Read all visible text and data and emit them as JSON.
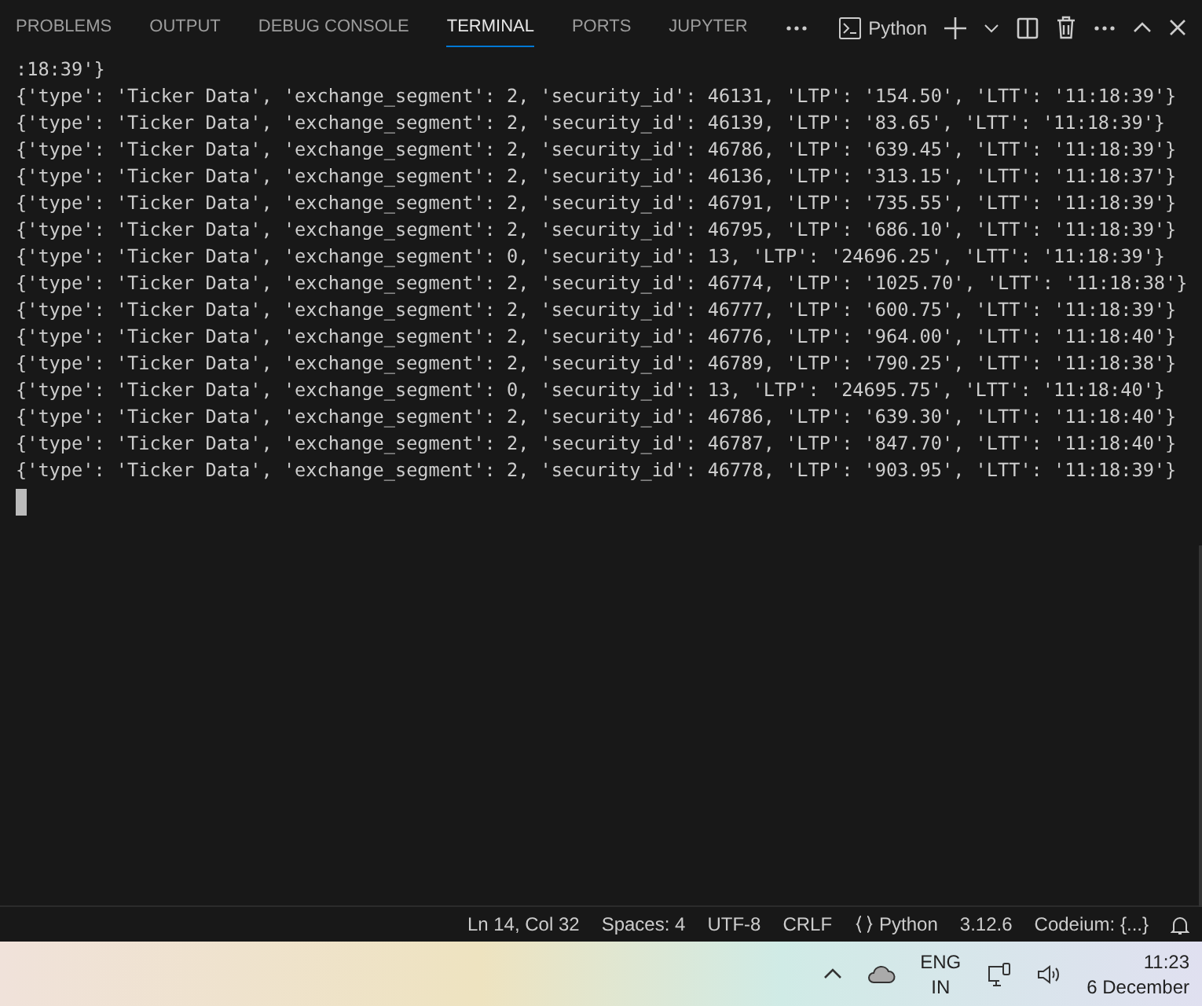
{
  "panel_tabs": [
    {
      "label": "PROBLEMS",
      "selected": false
    },
    {
      "label": "OUTPUT",
      "selected": false
    },
    {
      "label": "DEBUG CONSOLE",
      "selected": false
    },
    {
      "label": "TERMINAL",
      "selected": true
    },
    {
      "label": "PORTS",
      "selected": false
    },
    {
      "label": "JUPYTER",
      "selected": false
    }
  ],
  "terminal_profile": "Python",
  "terminal_lines": [
    ":18:39'}",
    "{'type': 'Ticker Data', 'exchange_segment': 2, 'security_id': 46131, 'LTP': '154.50', 'LTT': '11:18:39'}",
    "{'type': 'Ticker Data', 'exchange_segment': 2, 'security_id': 46139, 'LTP': '83.65', 'LTT': '11:18:39'}",
    "{'type': 'Ticker Data', 'exchange_segment': 2, 'security_id': 46786, 'LTP': '639.45', 'LTT': '11:18:39'}",
    "{'type': 'Ticker Data', 'exchange_segment': 2, 'security_id': 46136, 'LTP': '313.15', 'LTT': '11:18:37'}",
    "{'type': 'Ticker Data', 'exchange_segment': 2, 'security_id': 46791, 'LTP': '735.55', 'LTT': '11:18:39'}",
    "{'type': 'Ticker Data', 'exchange_segment': 2, 'security_id': 46795, 'LTP': '686.10', 'LTT': '11:18:39'}",
    "{'type': 'Ticker Data', 'exchange_segment': 0, 'security_id': 13, 'LTP': '24696.25', 'LTT': '11:18:39'}",
    "{'type': 'Ticker Data', 'exchange_segment': 2, 'security_id': 46774, 'LTP': '1025.70', 'LTT': '11:18:38'}",
    "{'type': 'Ticker Data', 'exchange_segment': 2, 'security_id': 46777, 'LTP': '600.75', 'LTT': '11:18:39'}",
    "{'type': 'Ticker Data', 'exchange_segment': 2, 'security_id': 46776, 'LTP': '964.00', 'LTT': '11:18:40'}",
    "{'type': 'Ticker Data', 'exchange_segment': 2, 'security_id': 46789, 'LTP': '790.25', 'LTT': '11:18:38'}",
    "{'type': 'Ticker Data', 'exchange_segment': 0, 'security_id': 13, 'LTP': '24695.75', 'LTT': '11:18:40'}",
    "{'type': 'Ticker Data', 'exchange_segment': 2, 'security_id': 46786, 'LTP': '639.30', 'LTT': '11:18:40'}",
    "{'type': 'Ticker Data', 'exchange_segment': 2, 'security_id': 46787, 'LTP': '847.70', 'LTT': '11:18:40'}",
    "{'type': 'Ticker Data', 'exchange_segment': 2, 'security_id': 46778, 'LTP': '903.95', 'LTT': '11:18:39'}"
  ],
  "status_bar": {
    "cursor_position": "Ln 14, Col 32",
    "indentation": "Spaces: 4",
    "encoding": "UTF-8",
    "line_ending": "CRLF",
    "language": "Python",
    "python_version": "3.12.6",
    "codeium": "Codeium: {...}"
  },
  "taskbar": {
    "language_line_1": "ENG",
    "language_line_2": "IN",
    "time": "11:23",
    "date": "6 December"
  }
}
